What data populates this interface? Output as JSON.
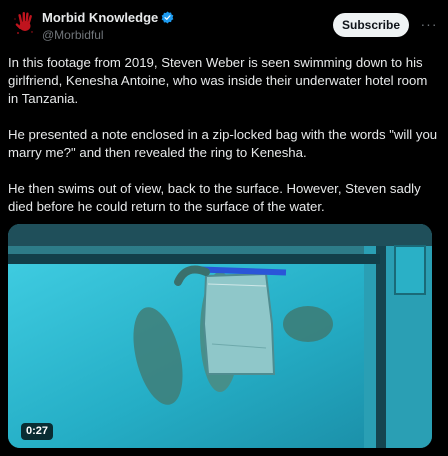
{
  "post": {
    "author_name": "Morbid Knowledge",
    "author_handle": "@Morbidful",
    "subscribe_label": "Subscribe",
    "more_label": "···",
    "paragraphs": [
      "In this footage from 2019, Steven Weber is seen swimming down to his girlfriend, Kenesha Antoine, who was inside their underwater hotel room in Tanzania.",
      "He presented a note enclosed in a zip-locked bag with the words \"will you marry me?\" and then revealed the ring to Kenesha.",
      "He then swims out of view, back to the surface. However, Steven sadly died before he could return to the surface of the water."
    ],
    "video": {
      "duration": "0:27"
    }
  },
  "colors": {
    "background": "#000000",
    "text": "#e7e9ea",
    "secondary_text": "#71767b",
    "verified": "#1d9bf0",
    "water": "#28b4c8",
    "avatar_hand": "#c0141e"
  },
  "icons": {
    "avatar": "red-handprint-icon",
    "verified": "verified-badge-icon",
    "more": "more-options-icon"
  }
}
